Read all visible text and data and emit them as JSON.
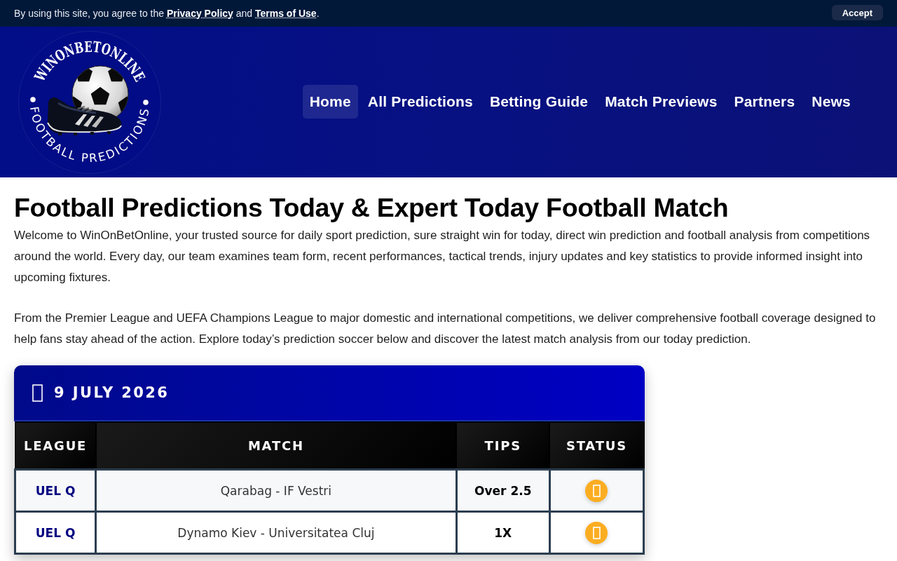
{
  "cookie_bar": {
    "notice": [
      {
        "kind": "text",
        "text": "By using this site, you agree to the "
      },
      {
        "kind": "link",
        "text": "Privacy Policy"
      },
      {
        "kind": "text",
        "text": " and "
      },
      {
        "kind": "link",
        "text": "Terms of Use"
      },
      {
        "kind": "text",
        "text": "."
      }
    ],
    "button": "Accept"
  },
  "header": {
    "logo": {
      "title": "WINONBETONLINE",
      "subtitle": "FOOTBALL PREDICTIONS"
    },
    "nav": [
      {
        "label": "Home",
        "selected": true
      },
      {
        "label": "All Predictions",
        "selected": false
      },
      {
        "label": "Betting Guide",
        "selected": false
      },
      {
        "label": "Match Previews",
        "selected": false
      },
      {
        "label": "Partners",
        "selected": false
      },
      {
        "label": "News",
        "selected": false
      }
    ]
  },
  "intro": {
    "title": "Football Predictions Today & Expert Today Football Match",
    "paragraphs": [
      "Welcome to WinOnBetOnline, your trusted source for daily sport prediction, sure straight win for today, direct win prediction and football analysis from competitions around the world. Every day, our team examines team form, recent performances, tactical trends, injury updates and key statistics to provide informed insight into upcoming fixtures.",
      "From the Premier League and UEFA Champions League to major domestic and international competitions, we deliver comprehensive football coverage designed to help fans stay ahead of the action. Explore today’s prediction soccer below and discover the latest match analysis from our today prediction."
    ]
  },
  "predictions": {
    "date": "9 JULY 2026",
    "columns": [
      "LEAGUE",
      "MATCH",
      "TIPS",
      "STATUS"
    ],
    "rows": [
      {
        "league": "UEL Q",
        "match": "Qarabag - IF Vestri",
        "tip": "Over 2.5",
        "color": "#fbad21"
      },
      {
        "league": "UEL Q",
        "match": "Dynamo Kiev - Universitatea Cluj",
        "tip": "1X",
        "color": "#fbad21"
      }
    ]
  }
}
